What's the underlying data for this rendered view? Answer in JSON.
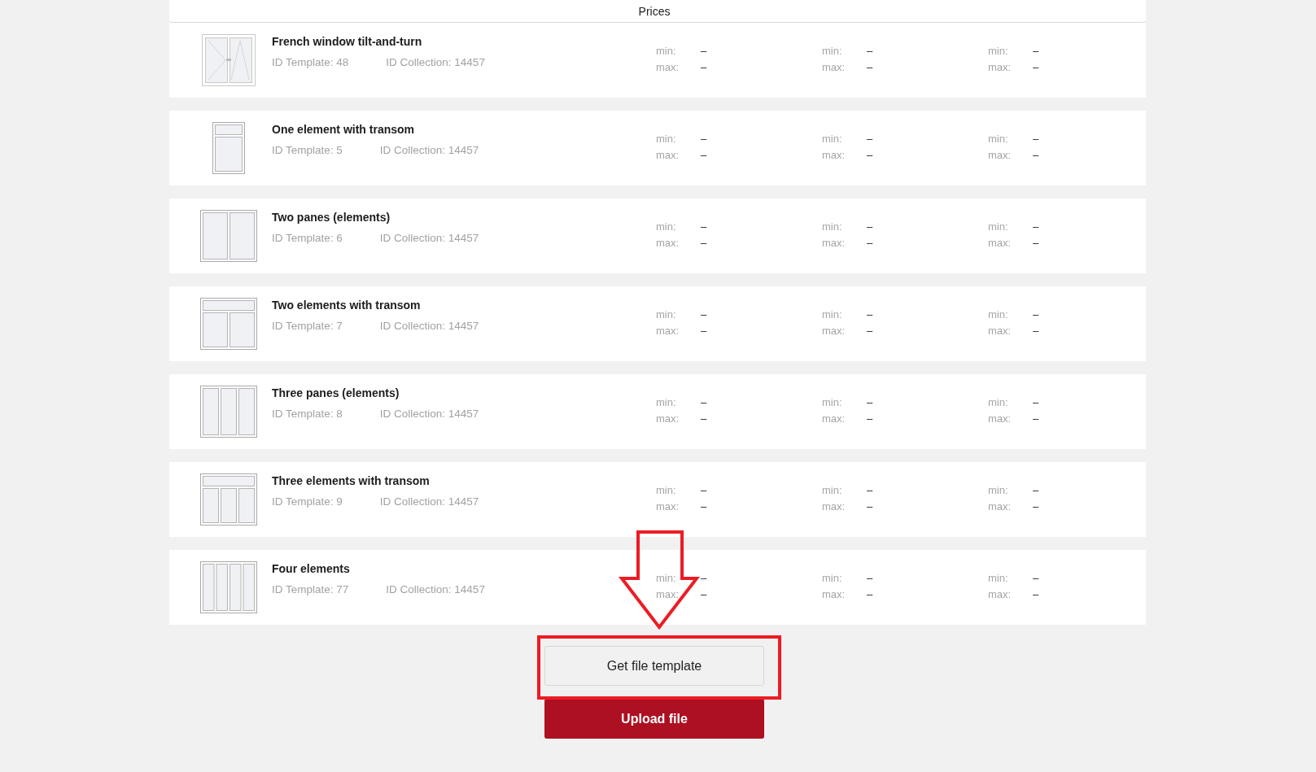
{
  "header": {
    "title": "Prices"
  },
  "rows": [
    {
      "kind": "french",
      "title": "French window tilt-and-turn",
      "template": "ID Template: 48",
      "collection": "ID Collection: 14457",
      "prices": [
        {
          "min_label": "min:",
          "min": "–",
          "max_label": "max:",
          "max": "–"
        },
        {
          "min_label": "min:",
          "min": "–",
          "max_label": "max:",
          "max": "–"
        },
        {
          "min_label": "min:",
          "min": "–",
          "max_label": "max:",
          "max": "–"
        }
      ]
    },
    {
      "kind": "transom-1",
      "title": "One element with transom",
      "template": "ID Template: 5",
      "collection": "ID Collection: 14457",
      "prices": [
        {
          "min_label": "min:",
          "min": "–",
          "max_label": "max:",
          "max": "–"
        },
        {
          "min_label": "min:",
          "min": "–",
          "max_label": "max:",
          "max": "–"
        },
        {
          "min_label": "min:",
          "min": "–",
          "max_label": "max:",
          "max": "–"
        }
      ]
    },
    {
      "kind": "panes-2",
      "title": "Two panes (elements)",
      "template": "ID Template: 6",
      "collection": "ID Collection: 14457",
      "prices": [
        {
          "min_label": "min:",
          "min": "–",
          "max_label": "max:",
          "max": "–"
        },
        {
          "min_label": "min:",
          "min": "–",
          "max_label": "max:",
          "max": "–"
        },
        {
          "min_label": "min:",
          "min": "–",
          "max_label": "max:",
          "max": "–"
        }
      ]
    },
    {
      "kind": "transom-2",
      "title": "Two elements with transom",
      "template": "ID Template: 7",
      "collection": "ID Collection: 14457",
      "prices": [
        {
          "min_label": "min:",
          "min": "–",
          "max_label": "max:",
          "max": "–"
        },
        {
          "min_label": "min:",
          "min": "–",
          "max_label": "max:",
          "max": "–"
        },
        {
          "min_label": "min:",
          "min": "–",
          "max_label": "max:",
          "max": "–"
        }
      ]
    },
    {
      "kind": "panes-3",
      "title": "Three panes (elements)",
      "template": "ID Template: 8",
      "collection": "ID Collection: 14457",
      "prices": [
        {
          "min_label": "min:",
          "min": "–",
          "max_label": "max:",
          "max": "–"
        },
        {
          "min_label": "min:",
          "min": "–",
          "max_label": "max:",
          "max": "–"
        },
        {
          "min_label": "min:",
          "min": "–",
          "max_label": "max:",
          "max": "–"
        }
      ]
    },
    {
      "kind": "transom-3",
      "title": "Three elements with transom",
      "template": "ID Template: 9",
      "collection": "ID Collection: 14457",
      "prices": [
        {
          "min_label": "min:",
          "min": "–",
          "max_label": "max:",
          "max": "–"
        },
        {
          "min_label": "min:",
          "min": "–",
          "max_label": "max:",
          "max": "–"
        },
        {
          "min_label": "min:",
          "min": "–",
          "max_label": "max:",
          "max": "–"
        }
      ]
    },
    {
      "kind": "panes-4",
      "title": "Four elements",
      "template": "ID Template: 77",
      "collection": "ID Collection: 14457",
      "prices": [
        {
          "min_label": "min:",
          "min": "–",
          "max_label": "max:",
          "max": "–"
        },
        {
          "min_label": "min:",
          "min": "–",
          "max_label": "max:",
          "max": "–"
        },
        {
          "min_label": "min:",
          "min": "–",
          "max_label": "max:",
          "max": "–"
        }
      ]
    }
  ],
  "buttons": [
    {
      "kind": "secondary",
      "label": "Get file template"
    },
    {
      "kind": "primary",
      "label": "Upload file"
    }
  ]
}
